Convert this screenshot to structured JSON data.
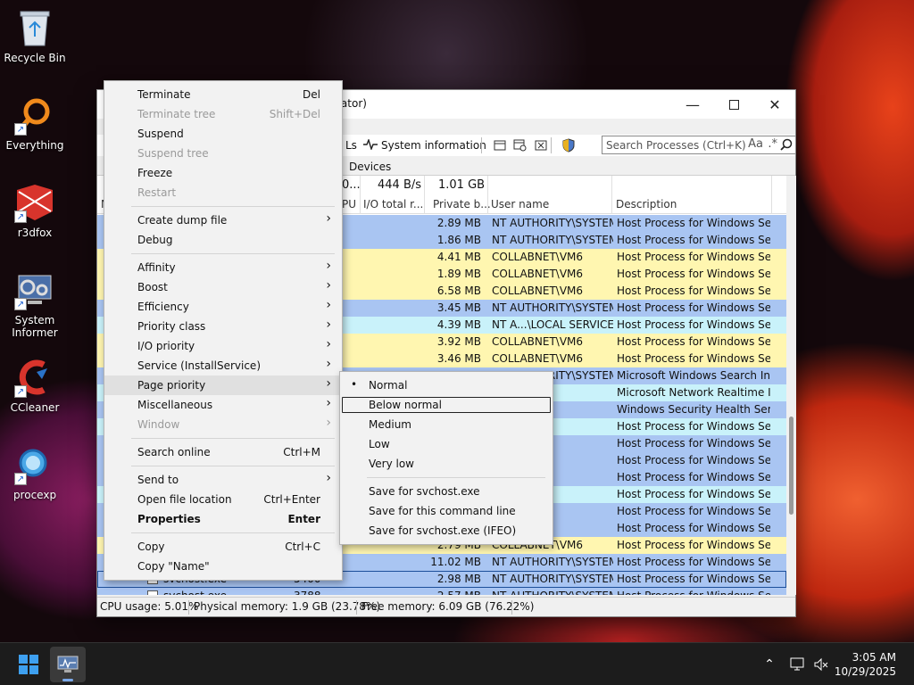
{
  "desktop": {
    "icons": [
      {
        "label": "Recycle Bin",
        "icon": "recycle-bin-icon"
      },
      {
        "label": "Everything",
        "icon": "search-magnifier-icon"
      },
      {
        "label": "r3dfox",
        "icon": "browser-icon"
      },
      {
        "label": "System Informer",
        "icon": "system-informer-icon"
      },
      {
        "label": "CCleaner",
        "icon": "ccleaner-icon"
      },
      {
        "label": "procexp",
        "icon": "process-explorer-icon"
      }
    ]
  },
  "window": {
    "title_fragment": "rator)",
    "toolbar": {
      "dlls_fragment": "Ls",
      "system_information": "System information"
    },
    "search_placeholder": "Search Processes (Ctrl+K)",
    "search_case": "Aa",
    "search_regex": ".*",
    "tabs": {
      "devices": "Devices"
    },
    "summary": {
      "cpu_fragment": "0...",
      "io_total": "444 B/s",
      "private_bytes": "1.01 GB"
    },
    "columns": {
      "cpu_fragment": "PU",
      "io_total": "I/O total r...",
      "private_bytes": "Private b...",
      "user_name": "User name",
      "description": "Description",
      "name_fragment": "N"
    },
    "rows": [
      {
        "priv": "2.89 MB",
        "user": "NT AUTHORITY\\SYSTEM",
        "desc": "Host Process for Windows Ser...",
        "color": "#a9c5f2"
      },
      {
        "priv": "1.86 MB",
        "user": "NT AUTHORITY\\SYSTEM",
        "desc": "Host Process for Windows Ser...",
        "color": "#a9c5f2"
      },
      {
        "priv": "4.41 MB",
        "user": "COLLABNET\\VM6",
        "desc": "Host Process for Windows Ser...",
        "color": "#fff6b0"
      },
      {
        "priv": "1.89 MB",
        "user": "COLLABNET\\VM6",
        "desc": "Host Process for Windows Ser...",
        "color": "#fff6b0"
      },
      {
        "priv": "6.58 MB",
        "user": "COLLABNET\\VM6",
        "desc": "Host Process for Windows Ser...",
        "color": "#fff6b0"
      },
      {
        "priv": "3.45 MB",
        "user": "NT AUTHORITY\\SYSTEM",
        "desc": "Host Process for Windows Ser...",
        "color": "#a9c5f2"
      },
      {
        "priv": "4.39 MB",
        "user": "NT A...\\LOCAL SERVICE",
        "desc": "Host Process for Windows Ser...",
        "color": "#c9f2fa"
      },
      {
        "priv": "3.92 MB",
        "user": "COLLABNET\\VM6",
        "desc": "Host Process for Windows Ser...",
        "color": "#fff6b0"
      },
      {
        "priv": "3.46 MB",
        "user": "COLLABNET\\VM6",
        "desc": "Host Process for Windows Ser...",
        "color": "#fff6b0"
      },
      {
        "priv": "",
        "user": "NT AUTHORITY\\SYSTEM",
        "desc": "Microsoft Windows Search In...",
        "color": "#a9c5f2"
      },
      {
        "priv": "",
        "user": "AL SERVICE",
        "desc": "Microsoft Network Realtime I...",
        "color": "#c9f2fa"
      },
      {
        "priv": "",
        "user": "SYSTEM",
        "desc": "Windows Security Health Serv...",
        "color": "#a9c5f2"
      },
      {
        "priv": "",
        "user": "AL SERVICE",
        "desc": "Host Process for Windows Ser...",
        "color": "#c9f2fa"
      },
      {
        "priv": "",
        "user": "SYSTEM",
        "desc": "Host Process for Windows Ser...",
        "color": "#a9c5f2"
      },
      {
        "priv": "",
        "user": "SYSTEM",
        "desc": "Host Process for Windows Ser...",
        "color": "#a9c5f2"
      },
      {
        "priv": "",
        "user": "SYSTEM",
        "desc": "Host Process for Windows Ser...",
        "color": "#a9c5f2"
      },
      {
        "priv": "",
        "user": "AL SERVICE",
        "desc": "Host Process for Windows Ser...",
        "color": "#c9f2fa"
      },
      {
        "priv": "",
        "user": "SYSTEM",
        "desc": "Host Process for Windows Ser...",
        "color": "#a9c5f2"
      },
      {
        "priv": "",
        "user": "SYSTEM",
        "desc": "Host Process for Windows Ser...",
        "color": "#a9c5f2"
      },
      {
        "priv": "2.79 MB",
        "user": "COLLABNET\\VM6",
        "desc": "Host Process for Windows Ser...",
        "color": "#fff6b0"
      },
      {
        "io": ".01",
        "priv": "11.02 MB",
        "user": "NT AUTHORITY\\SYSTEM",
        "desc": "Host Process for Windows Ser...",
        "color": "#a9c5f2"
      },
      {
        "name": "svchost.exe",
        "pid": "5400",
        "priv": "2.98 MB",
        "user": "NT AUTHORITY\\SYSTEM",
        "desc": "Host Process for Windows Ser...",
        "color": "#a9c5f2",
        "selected": true
      },
      {
        "name": "svchost.exe",
        "pid": "3788",
        "priv": "2.57 MB",
        "user": "NT AUTHORITY\\SYSTEM",
        "desc": "Host Process for Windows Ser...",
        "color": "#a9c5f2"
      }
    ],
    "status": {
      "cpu": "CPU usage: 5.01%",
      "physical": "Physical memory: 1.9 GB (23.78%)",
      "free": "Free memory: 6.09 GB (76.22%)"
    }
  },
  "context_menu": {
    "items": [
      {
        "label": "Terminate",
        "shortcut": "Del"
      },
      {
        "label": "Terminate tree",
        "shortcut": "Shift+Del",
        "disabled": true
      },
      {
        "label": "Suspend"
      },
      {
        "label": "Suspend tree",
        "disabled": true
      },
      {
        "label": "Freeze"
      },
      {
        "label": "Restart",
        "disabled": true
      },
      {
        "sep": true
      },
      {
        "label": "Create dump file",
        "submenu": true
      },
      {
        "label": "Debug"
      },
      {
        "sep": true
      },
      {
        "label": "Affinity",
        "submenu": true
      },
      {
        "label": "Boost",
        "submenu": true
      },
      {
        "label": "Efficiency",
        "submenu": true
      },
      {
        "label": "Priority class",
        "submenu": true
      },
      {
        "label": "I/O priority",
        "submenu": true
      },
      {
        "label": "Service (InstallService)",
        "submenu": true
      },
      {
        "label": "Page priority",
        "submenu": true,
        "hover": true
      },
      {
        "label": "Miscellaneous",
        "submenu": true
      },
      {
        "label": "Window",
        "submenu": true,
        "disabled": true
      },
      {
        "sep": true
      },
      {
        "label": "Search online",
        "shortcut": "Ctrl+M"
      },
      {
        "sep": true
      },
      {
        "label": "Send to",
        "submenu": true
      },
      {
        "label": "Open file location",
        "shortcut": "Ctrl+Enter"
      },
      {
        "label": "Properties",
        "shortcut": "Enter",
        "bold": true
      },
      {
        "sep": true
      },
      {
        "label": "Copy",
        "shortcut": "Ctrl+C"
      },
      {
        "label": "Copy \"Name\""
      }
    ]
  },
  "submenu": {
    "items": [
      {
        "label": "Normal",
        "checked": true
      },
      {
        "label": "Below normal",
        "focused": true
      },
      {
        "label": "Medium"
      },
      {
        "label": "Low"
      },
      {
        "label": "Very low"
      },
      {
        "sep": true
      },
      {
        "label": "Save for svchost.exe"
      },
      {
        "label": "Save for this command line"
      },
      {
        "label": "Save for svchost.exe (IFEO)"
      }
    ]
  },
  "taskbar": {
    "time": "3:05 AM",
    "date": "10/29/2025"
  }
}
